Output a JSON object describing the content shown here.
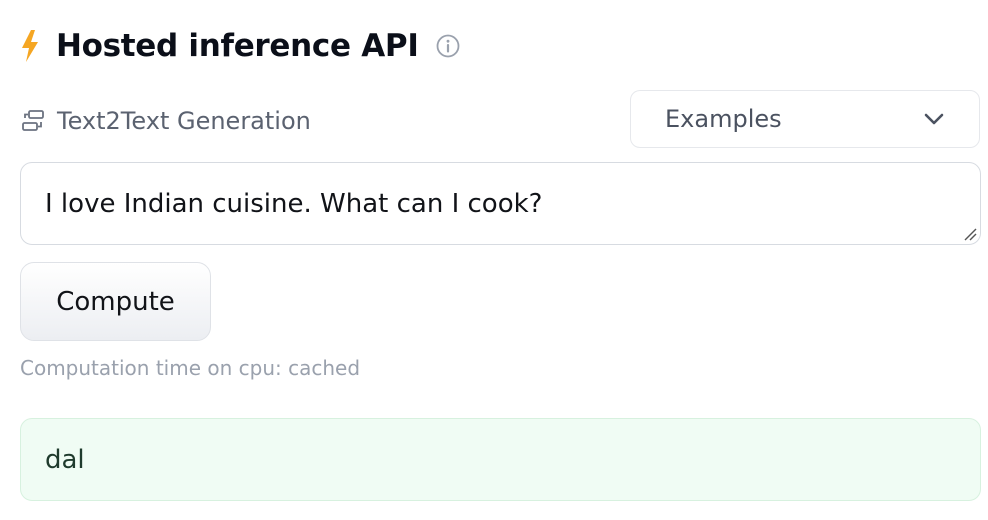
{
  "header": {
    "title": "Hosted inference API",
    "bolt_icon": "lightning-bolt-icon",
    "info_icon": "info-icon",
    "accent_color": "#f5a623"
  },
  "task": {
    "icon": "text2text-task-icon",
    "label": "Text2Text Generation"
  },
  "examples_dropdown": {
    "label": "Examples",
    "icon": "chevron-down-icon"
  },
  "input": {
    "value": "I love Indian cuisine. What can I cook?"
  },
  "compute_button": {
    "label": "Compute"
  },
  "status": {
    "computation_time": "Computation time on cpu: cached"
  },
  "output": {
    "text": "dal",
    "background_color": "#f0fcf4"
  }
}
